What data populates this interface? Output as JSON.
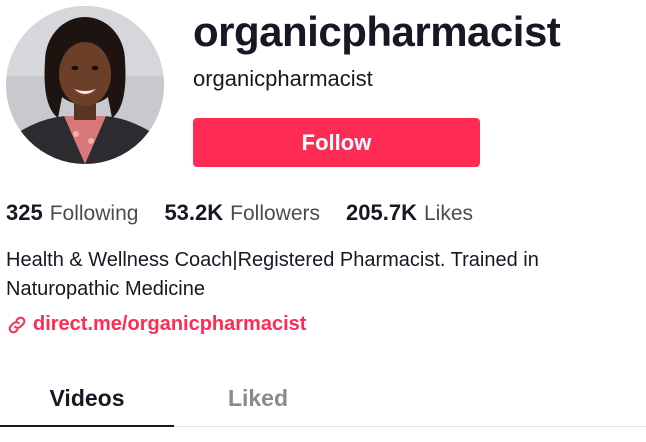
{
  "profile": {
    "avatar_icon": "profile-photo",
    "username": "organicpharmacist",
    "nickname": "organicpharmacist",
    "follow_label": "Follow"
  },
  "stats": [
    {
      "value": "325",
      "label": "Following"
    },
    {
      "value": "53.2K",
      "label": "Followers"
    },
    {
      "value": "205.7K",
      "label": "Likes"
    }
  ],
  "bio": "Health & Wellness Coach|Registered Pharmacist. Trained in Naturopathic Medicine",
  "link": {
    "icon": "link-icon",
    "text": "direct.me/organicpharmacist"
  },
  "tabs": [
    {
      "label": "Videos",
      "active": true
    },
    {
      "label": "Liked",
      "active": false
    }
  ],
  "colors": {
    "accent": "#fe2c55",
    "text": "#161823",
    "muted": "#8a8b91"
  }
}
